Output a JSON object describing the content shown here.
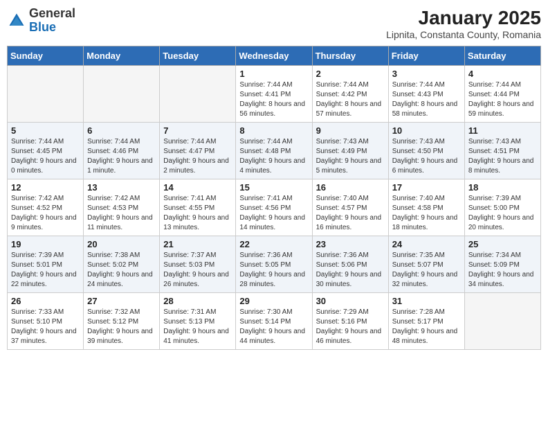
{
  "header": {
    "logo_general": "General",
    "logo_blue": "Blue",
    "title": "January 2025",
    "subtitle": "Lipnita, Constanta County, Romania"
  },
  "weekdays": [
    "Sunday",
    "Monday",
    "Tuesday",
    "Wednesday",
    "Thursday",
    "Friday",
    "Saturday"
  ],
  "weeks": [
    [
      {
        "day": "",
        "sunrise": "",
        "sunset": "",
        "daylight": "",
        "empty": true
      },
      {
        "day": "",
        "sunrise": "",
        "sunset": "",
        "daylight": "",
        "empty": true
      },
      {
        "day": "",
        "sunrise": "",
        "sunset": "",
        "daylight": "",
        "empty": true
      },
      {
        "day": "1",
        "sunrise": "Sunrise: 7:44 AM",
        "sunset": "Sunset: 4:41 PM",
        "daylight": "Daylight: 8 hours and 56 minutes.",
        "empty": false
      },
      {
        "day": "2",
        "sunrise": "Sunrise: 7:44 AM",
        "sunset": "Sunset: 4:42 PM",
        "daylight": "Daylight: 8 hours and 57 minutes.",
        "empty": false
      },
      {
        "day": "3",
        "sunrise": "Sunrise: 7:44 AM",
        "sunset": "Sunset: 4:43 PM",
        "daylight": "Daylight: 8 hours and 58 minutes.",
        "empty": false
      },
      {
        "day": "4",
        "sunrise": "Sunrise: 7:44 AM",
        "sunset": "Sunset: 4:44 PM",
        "daylight": "Daylight: 8 hours and 59 minutes.",
        "empty": false
      }
    ],
    [
      {
        "day": "5",
        "sunrise": "Sunrise: 7:44 AM",
        "sunset": "Sunset: 4:45 PM",
        "daylight": "Daylight: 9 hours and 0 minutes.",
        "empty": false
      },
      {
        "day": "6",
        "sunrise": "Sunrise: 7:44 AM",
        "sunset": "Sunset: 4:46 PM",
        "daylight": "Daylight: 9 hours and 1 minute.",
        "empty": false
      },
      {
        "day": "7",
        "sunrise": "Sunrise: 7:44 AM",
        "sunset": "Sunset: 4:47 PM",
        "daylight": "Daylight: 9 hours and 2 minutes.",
        "empty": false
      },
      {
        "day": "8",
        "sunrise": "Sunrise: 7:44 AM",
        "sunset": "Sunset: 4:48 PM",
        "daylight": "Daylight: 9 hours and 4 minutes.",
        "empty": false
      },
      {
        "day": "9",
        "sunrise": "Sunrise: 7:43 AM",
        "sunset": "Sunset: 4:49 PM",
        "daylight": "Daylight: 9 hours and 5 minutes.",
        "empty": false
      },
      {
        "day": "10",
        "sunrise": "Sunrise: 7:43 AM",
        "sunset": "Sunset: 4:50 PM",
        "daylight": "Daylight: 9 hours and 6 minutes.",
        "empty": false
      },
      {
        "day": "11",
        "sunrise": "Sunrise: 7:43 AM",
        "sunset": "Sunset: 4:51 PM",
        "daylight": "Daylight: 9 hours and 8 minutes.",
        "empty": false
      }
    ],
    [
      {
        "day": "12",
        "sunrise": "Sunrise: 7:42 AM",
        "sunset": "Sunset: 4:52 PM",
        "daylight": "Daylight: 9 hours and 9 minutes.",
        "empty": false
      },
      {
        "day": "13",
        "sunrise": "Sunrise: 7:42 AM",
        "sunset": "Sunset: 4:53 PM",
        "daylight": "Daylight: 9 hours and 11 minutes.",
        "empty": false
      },
      {
        "day": "14",
        "sunrise": "Sunrise: 7:41 AM",
        "sunset": "Sunset: 4:55 PM",
        "daylight": "Daylight: 9 hours and 13 minutes.",
        "empty": false
      },
      {
        "day": "15",
        "sunrise": "Sunrise: 7:41 AM",
        "sunset": "Sunset: 4:56 PM",
        "daylight": "Daylight: 9 hours and 14 minutes.",
        "empty": false
      },
      {
        "day": "16",
        "sunrise": "Sunrise: 7:40 AM",
        "sunset": "Sunset: 4:57 PM",
        "daylight": "Daylight: 9 hours and 16 minutes.",
        "empty": false
      },
      {
        "day": "17",
        "sunrise": "Sunrise: 7:40 AM",
        "sunset": "Sunset: 4:58 PM",
        "daylight": "Daylight: 9 hours and 18 minutes.",
        "empty": false
      },
      {
        "day": "18",
        "sunrise": "Sunrise: 7:39 AM",
        "sunset": "Sunset: 5:00 PM",
        "daylight": "Daylight: 9 hours and 20 minutes.",
        "empty": false
      }
    ],
    [
      {
        "day": "19",
        "sunrise": "Sunrise: 7:39 AM",
        "sunset": "Sunset: 5:01 PM",
        "daylight": "Daylight: 9 hours and 22 minutes.",
        "empty": false
      },
      {
        "day": "20",
        "sunrise": "Sunrise: 7:38 AM",
        "sunset": "Sunset: 5:02 PM",
        "daylight": "Daylight: 9 hours and 24 minutes.",
        "empty": false
      },
      {
        "day": "21",
        "sunrise": "Sunrise: 7:37 AM",
        "sunset": "Sunset: 5:03 PM",
        "daylight": "Daylight: 9 hours and 26 minutes.",
        "empty": false
      },
      {
        "day": "22",
        "sunrise": "Sunrise: 7:36 AM",
        "sunset": "Sunset: 5:05 PM",
        "daylight": "Daylight: 9 hours and 28 minutes.",
        "empty": false
      },
      {
        "day": "23",
        "sunrise": "Sunrise: 7:36 AM",
        "sunset": "Sunset: 5:06 PM",
        "daylight": "Daylight: 9 hours and 30 minutes.",
        "empty": false
      },
      {
        "day": "24",
        "sunrise": "Sunrise: 7:35 AM",
        "sunset": "Sunset: 5:07 PM",
        "daylight": "Daylight: 9 hours and 32 minutes.",
        "empty": false
      },
      {
        "day": "25",
        "sunrise": "Sunrise: 7:34 AM",
        "sunset": "Sunset: 5:09 PM",
        "daylight": "Daylight: 9 hours and 34 minutes.",
        "empty": false
      }
    ],
    [
      {
        "day": "26",
        "sunrise": "Sunrise: 7:33 AM",
        "sunset": "Sunset: 5:10 PM",
        "daylight": "Daylight: 9 hours and 37 minutes.",
        "empty": false
      },
      {
        "day": "27",
        "sunrise": "Sunrise: 7:32 AM",
        "sunset": "Sunset: 5:12 PM",
        "daylight": "Daylight: 9 hours and 39 minutes.",
        "empty": false
      },
      {
        "day": "28",
        "sunrise": "Sunrise: 7:31 AM",
        "sunset": "Sunset: 5:13 PM",
        "daylight": "Daylight: 9 hours and 41 minutes.",
        "empty": false
      },
      {
        "day": "29",
        "sunrise": "Sunrise: 7:30 AM",
        "sunset": "Sunset: 5:14 PM",
        "daylight": "Daylight: 9 hours and 44 minutes.",
        "empty": false
      },
      {
        "day": "30",
        "sunrise": "Sunrise: 7:29 AM",
        "sunset": "Sunset: 5:16 PM",
        "daylight": "Daylight: 9 hours and 46 minutes.",
        "empty": false
      },
      {
        "day": "31",
        "sunrise": "Sunrise: 7:28 AM",
        "sunset": "Sunset: 5:17 PM",
        "daylight": "Daylight: 9 hours and 48 minutes.",
        "empty": false
      },
      {
        "day": "",
        "sunrise": "",
        "sunset": "",
        "daylight": "",
        "empty": true
      }
    ]
  ]
}
